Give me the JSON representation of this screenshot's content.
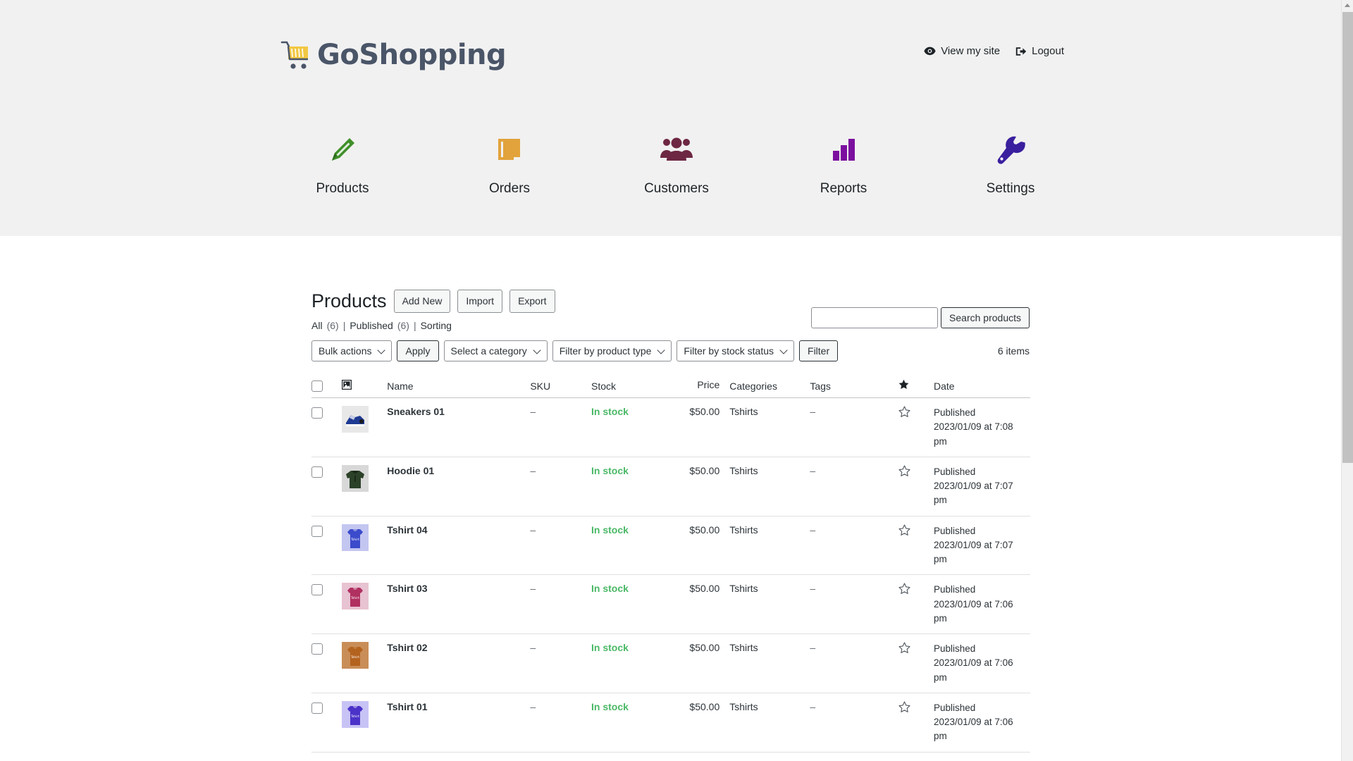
{
  "header": {
    "brand_name": "GoShopping",
    "brand_color": "#4a5568",
    "cart_color": "#f2c744",
    "links": [
      {
        "label": "View my site",
        "icon": "eye-icon"
      },
      {
        "label": "Logout",
        "icon": "logout-icon"
      }
    ]
  },
  "nav": {
    "items": [
      {
        "label": "Products",
        "icon": "pencil-icon",
        "color": "#3f8f29"
      },
      {
        "label": "Orders",
        "icon": "pages-icon",
        "color": "#e2a33c"
      },
      {
        "label": "Customers",
        "icon": "users-icon",
        "color": "#6d2742"
      },
      {
        "label": "Reports",
        "icon": "bar-chart-icon",
        "color": "#7b0f9e"
      },
      {
        "label": "Settings",
        "icon": "wrench-icon",
        "color": "#3a1f9e"
      }
    ]
  },
  "page": {
    "title": "Products",
    "buttons": [
      {
        "label": "Add New"
      },
      {
        "label": "Import"
      },
      {
        "label": "Export"
      }
    ],
    "views": [
      {
        "label": "All",
        "count": "(6)"
      },
      {
        "label": "Published",
        "count": "(6)"
      },
      {
        "label": "Sorting",
        "count": ""
      }
    ],
    "view_separator": "|"
  },
  "search": {
    "value": "",
    "placeholder": "",
    "button_label": "Search products"
  },
  "toolbar": {
    "bulk_actions_label": "Bulk actions",
    "apply_label": "Apply",
    "category_label": "Select a category",
    "product_type_label": "Filter by product type",
    "stock_status_label": "Filter by stock status",
    "filter_label": "Filter",
    "item_count": "6 items"
  },
  "table": {
    "columns": [
      {
        "key": "cb",
        "label": ""
      },
      {
        "key": "thumb",
        "label": "",
        "icon": "image-icon"
      },
      {
        "key": "name",
        "label": "Name"
      },
      {
        "key": "sku",
        "label": "SKU"
      },
      {
        "key": "stock",
        "label": "Stock"
      },
      {
        "key": "price",
        "label": "Price"
      },
      {
        "key": "cats",
        "label": "Categories"
      },
      {
        "key": "tags",
        "label": "Tags"
      },
      {
        "key": "feat",
        "label": "",
        "icon": "star-filled-icon"
      },
      {
        "key": "date",
        "label": "Date"
      }
    ],
    "rows": [
      {
        "name": "Sneakers 01",
        "sku": "–",
        "stock": "In stock",
        "price": "$50.00",
        "categories": "Tshirts",
        "tags": "–",
        "featured": false,
        "date_status": "Published",
        "date_value": "2023/01/09 at 7:08 pm",
        "thumb_type": "sneaker",
        "thumb_bg": "#e8e8e8",
        "thumb_color": "#1f3a93"
      },
      {
        "name": "Hoodie 01",
        "sku": "–",
        "stock": "In stock",
        "price": "$50.00",
        "categories": "Tshirts",
        "tags": "–",
        "featured": false,
        "date_status": "Published",
        "date_value": "2023/01/09 at 7:07 pm",
        "thumb_type": "hoodie",
        "thumb_bg": "#d8d8d8",
        "thumb_color": "#2b4128"
      },
      {
        "name": "Tshirt 04",
        "sku": "–",
        "stock": "In stock",
        "price": "$50.00",
        "categories": "Tshirts",
        "tags": "–",
        "featured": false,
        "date_status": "Published",
        "date_value": "2023/01/09 at 7:07 pm",
        "thumb_type": "tshirt",
        "thumb_bg": "#c3c6f0",
        "thumb_color": "#3b4bcb"
      },
      {
        "name": "Tshirt 03",
        "sku": "–",
        "stock": "In stock",
        "price": "$50.00",
        "categories": "Tshirts",
        "tags": "–",
        "featured": false,
        "date_status": "Published",
        "date_value": "2023/01/09 at 7:06 pm",
        "thumb_type": "tshirt",
        "thumb_bg": "#e8c3d2",
        "thumb_color": "#b03060"
      },
      {
        "name": "Tshirt 02",
        "sku": "–",
        "stock": "In stock",
        "price": "$50.00",
        "categories": "Tshirts",
        "tags": "–",
        "featured": false,
        "date_status": "Published",
        "date_value": "2023/01/09 at 7:06 pm",
        "thumb_type": "tshirt",
        "thumb_bg": "#c98e58",
        "thumb_color": "#b4631f"
      },
      {
        "name": "Tshirt 01",
        "sku": "–",
        "stock": "In stock",
        "price": "$50.00",
        "categories": "Tshirts",
        "tags": "–",
        "featured": false,
        "date_status": "Published",
        "date_value": "2023/01/09 at 7:06 pm",
        "thumb_type": "tshirt",
        "thumb_bg": "#c8c3f5",
        "thumb_color": "#4b32c8"
      }
    ]
  }
}
